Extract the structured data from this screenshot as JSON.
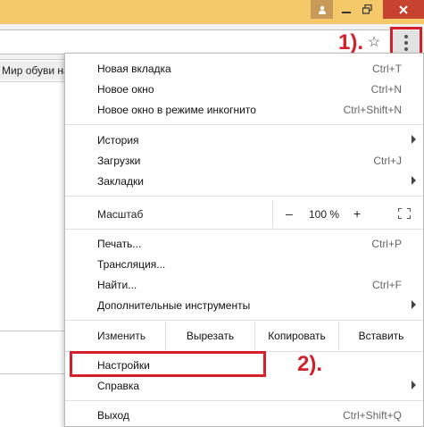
{
  "titlebar": {
    "profile_icon": "person-icon",
    "minimize_icon": "minimize-icon",
    "maximize_icon": "restore-icon",
    "close_icon": "close-icon",
    "colors": {
      "bar": "#f5c86a",
      "close": "#c7432f"
    }
  },
  "toolbar": {
    "star_glyph": "☆",
    "annotation_1": "1).",
    "annotation_color": "#d4202b"
  },
  "bookmarks": {
    "item": "Мир обуви на"
  },
  "menu": {
    "new_tab": {
      "label": "Новая вкладка",
      "shortcut": "Ctrl+T"
    },
    "new_window": {
      "label": "Новое окно",
      "shortcut": "Ctrl+N"
    },
    "incognito": {
      "label": "Новое окно в режиме инкогнито",
      "shortcut": "Ctrl+Shift+N"
    },
    "history": {
      "label": "История"
    },
    "downloads": {
      "label": "Загрузки",
      "shortcut": "Ctrl+J"
    },
    "bookmarks": {
      "label": "Закладки"
    },
    "zoom": {
      "label": "Масштаб",
      "minus": "–",
      "value": "100 %",
      "plus": "+"
    },
    "print": {
      "label": "Печать...",
      "shortcut": "Ctrl+P"
    },
    "cast": {
      "label": "Трансляция..."
    },
    "find": {
      "label": "Найти...",
      "shortcut": "Ctrl+F"
    },
    "more_tools": {
      "label": "Дополнительные инструменты"
    },
    "edit": {
      "label": "Изменить",
      "cut": "Вырезать",
      "copy": "Копировать",
      "paste": "Вставить"
    },
    "settings": {
      "label": "Настройки"
    },
    "help": {
      "label": "Справка"
    },
    "exit": {
      "label": "Выход",
      "shortcut": "Ctrl+Shift+Q"
    },
    "annotation_2": "2)."
  }
}
